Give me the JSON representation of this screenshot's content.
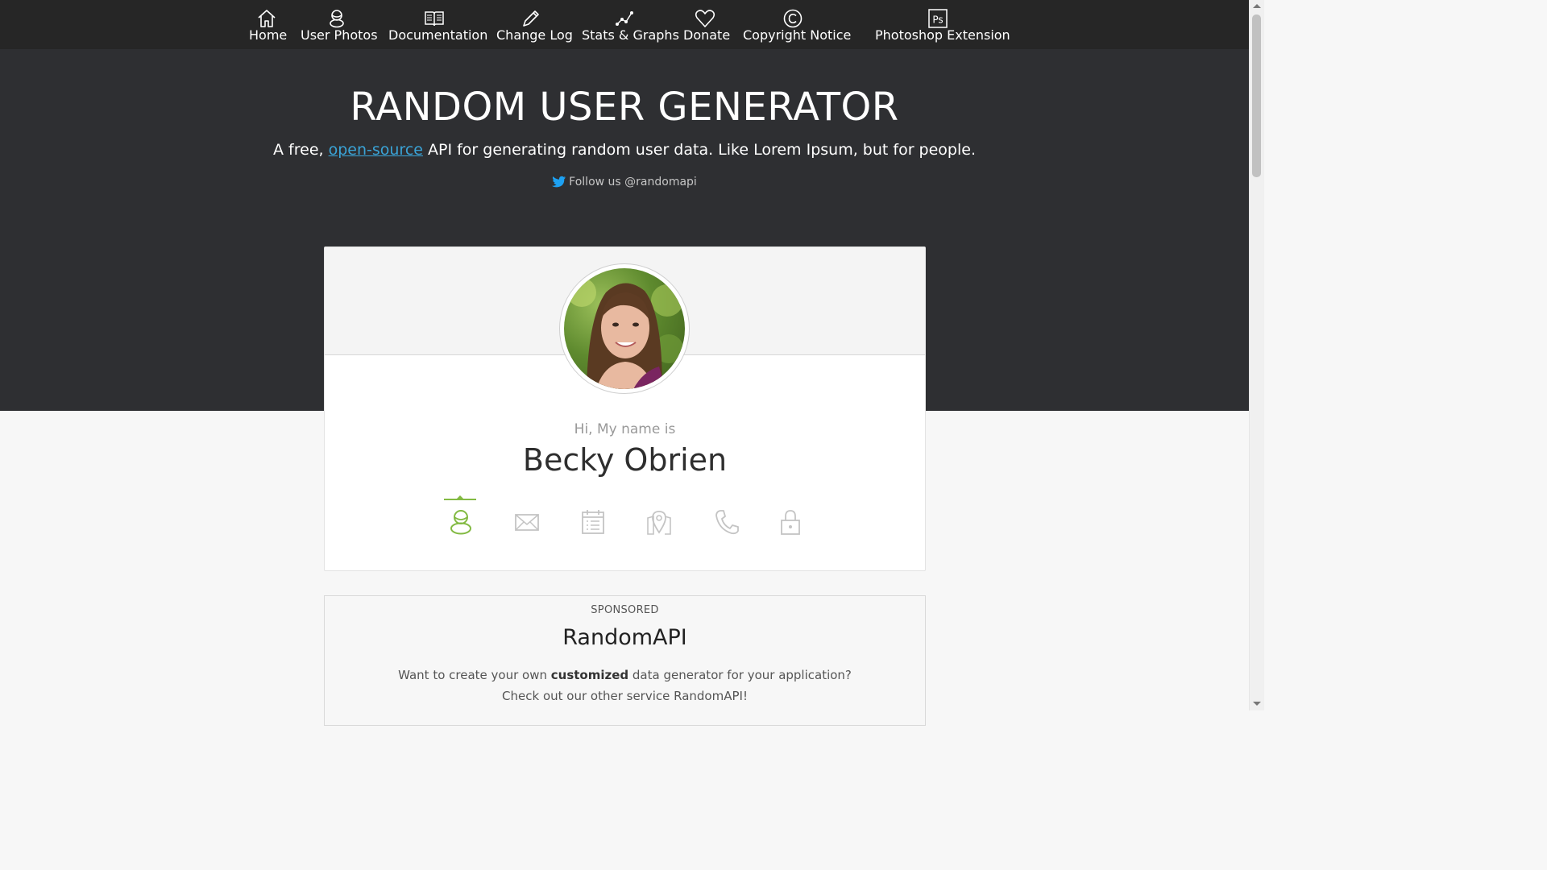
{
  "nav": {
    "items": [
      {
        "label": "Home",
        "icon": "home-icon"
      },
      {
        "label": "User Photos",
        "icon": "user-icon"
      },
      {
        "label": "Documentation",
        "icon": "book-icon"
      },
      {
        "label": "Change Log",
        "icon": "pencil-icon"
      },
      {
        "label": "Stats & Graphs",
        "icon": "graph-icon"
      },
      {
        "label": "Donate",
        "icon": "heart-icon"
      },
      {
        "label": "Copyright Notice",
        "icon": "copyright-icon"
      },
      {
        "label": "Photoshop Extension",
        "icon": "photoshop-icon",
        "icon_text": "Ps"
      }
    ]
  },
  "hero": {
    "title": "RANDOM USER GENERATOR",
    "subtitle_prefix": "A free, ",
    "subtitle_link": "open-source",
    "subtitle_suffix": " API for generating random user data. Like Lorem Ipsum, but for people.",
    "follow": "Follow us @randomapi"
  },
  "user": {
    "greeting": "Hi, My name is",
    "name": "Becky Obrien",
    "tabs": [
      {
        "icon": "user-icon",
        "active": true
      },
      {
        "icon": "envelope-icon",
        "active": false
      },
      {
        "icon": "calendar-icon",
        "active": false
      },
      {
        "icon": "map-icon",
        "active": false
      },
      {
        "icon": "phone-icon",
        "active": false
      },
      {
        "icon": "lock-icon",
        "active": false
      }
    ]
  },
  "sponsor": {
    "tag": "SPONSORED",
    "title": "RandomAPI",
    "line1_pre": "Want to create your own ",
    "line1_bold": "customized",
    "line1_post": " data generator for your application?",
    "line2": "Check out our other service RandomAPI!"
  },
  "colors": {
    "nav_bg": "#262626",
    "hero_bg": "#2e2f32",
    "accent_green": "#83ba43",
    "link_blue": "#3aa3d6",
    "twitter_blue": "#1da1f2"
  }
}
